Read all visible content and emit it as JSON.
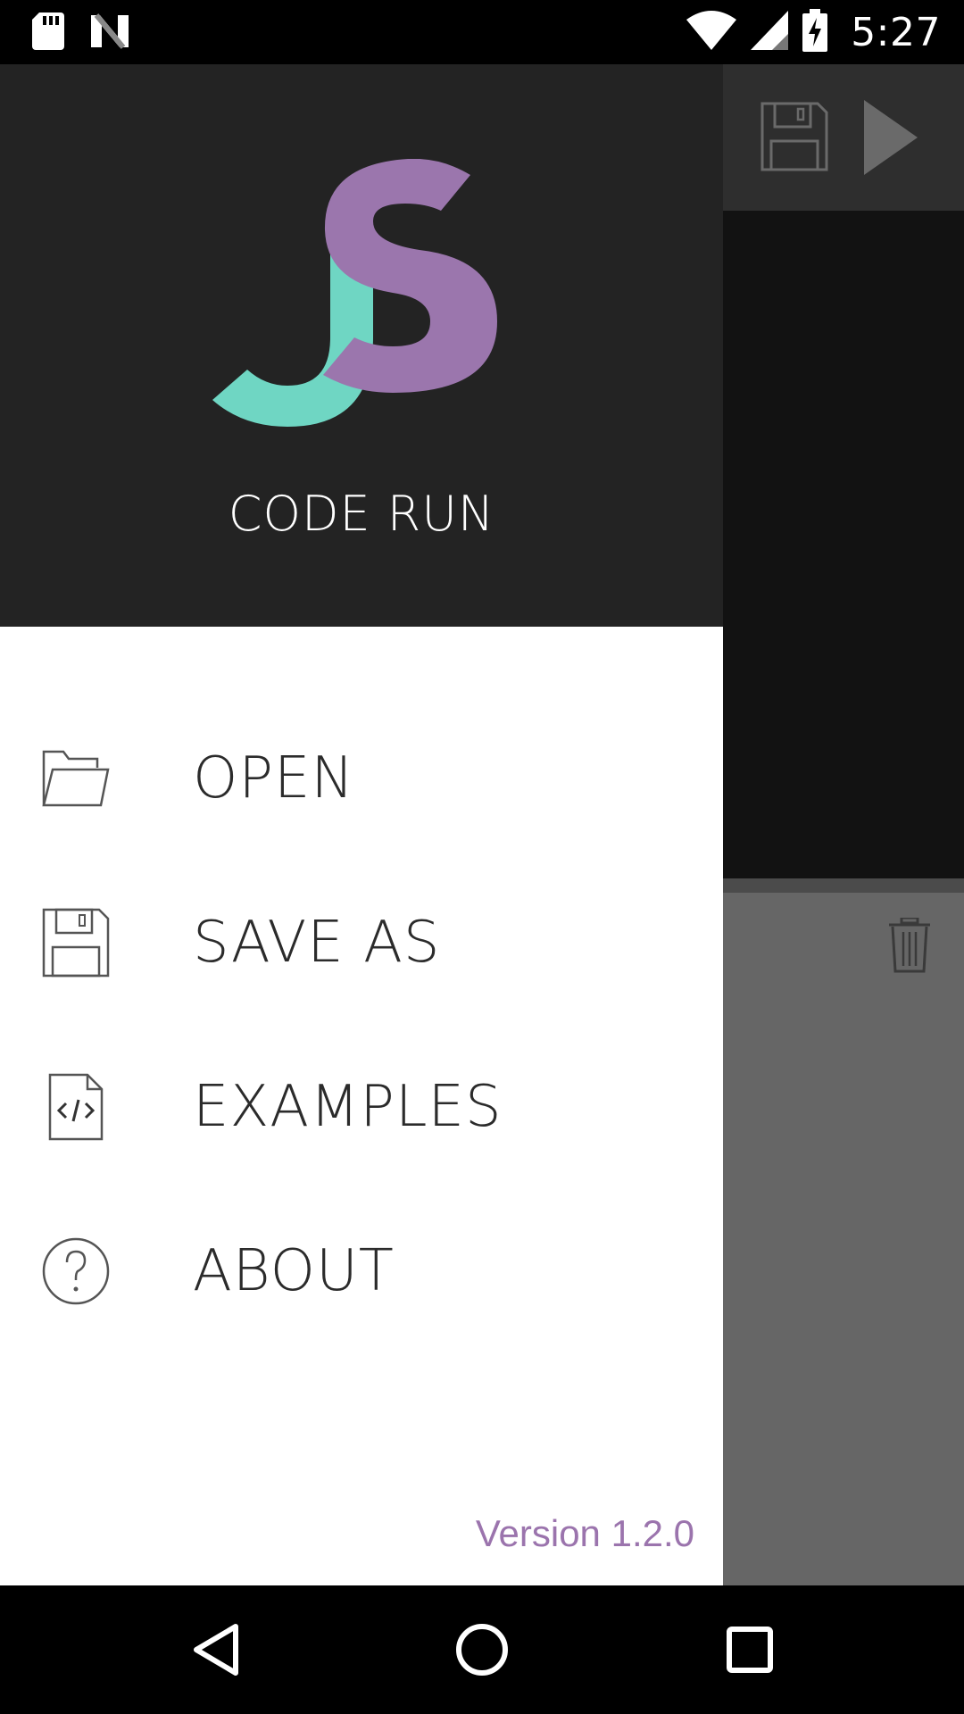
{
  "status_bar": {
    "time": "5:27",
    "icons": [
      "sd-card-icon",
      "n-logo-icon",
      "wifi-icon",
      "cell-signal-icon",
      "battery-charging-icon"
    ]
  },
  "app_behind": {
    "toolbar_icons": [
      "save-icon",
      "run-icon"
    ],
    "console_icon": "trash-icon"
  },
  "drawer": {
    "brand": "CODE RUN",
    "logo_colors": {
      "j": "#6fd6c3",
      "s": "#9b76ad"
    },
    "menu": [
      {
        "label": "OPEN",
        "icon": "folder-open-icon"
      },
      {
        "label": "SAVE AS",
        "icon": "save-icon"
      },
      {
        "label": "EXAMPLES",
        "icon": "code-file-icon"
      },
      {
        "label": "ABOUT",
        "icon": "help-circle-icon"
      }
    ],
    "version": "Version 1.2.0"
  },
  "nav_bar": {
    "buttons": [
      "back-icon",
      "home-icon",
      "recents-icon"
    ]
  },
  "colors": {
    "accent": "#9b74ad",
    "drawer_header": "#232323"
  }
}
